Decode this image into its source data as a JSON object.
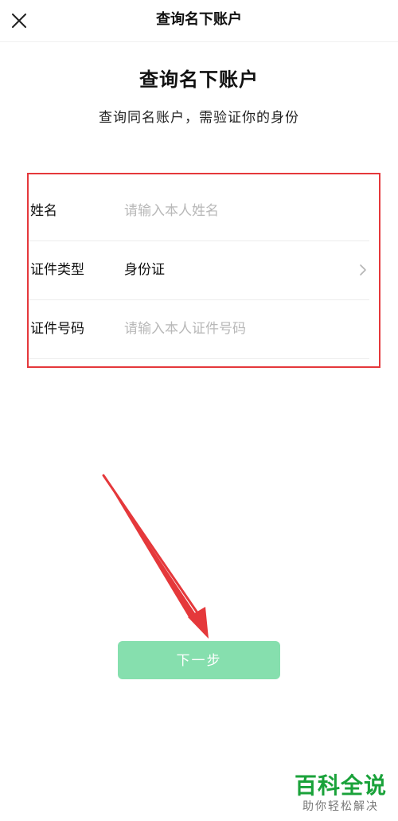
{
  "navbar": {
    "title": "查询名下账户",
    "close_icon": "close-icon"
  },
  "header": {
    "title": "查询名下账户",
    "subtitle": "查询同名账户，需验证你的身份"
  },
  "form": {
    "name": {
      "label": "姓名",
      "placeholder": "请输入本人姓名",
      "value": ""
    },
    "id_type": {
      "label": "证件类型",
      "value": "身份证",
      "chevron_icon": "chevron-right-icon"
    },
    "id_number": {
      "label": "证件号码",
      "placeholder": "请输入本人证件号码",
      "value": ""
    }
  },
  "actions": {
    "next_label": "下一步"
  },
  "watermark": {
    "main": "百科全说",
    "sub": "助你轻松解决"
  },
  "colors": {
    "annotation": "#e5383b",
    "button": "#86dfae",
    "watermark": "#1aa23a"
  }
}
